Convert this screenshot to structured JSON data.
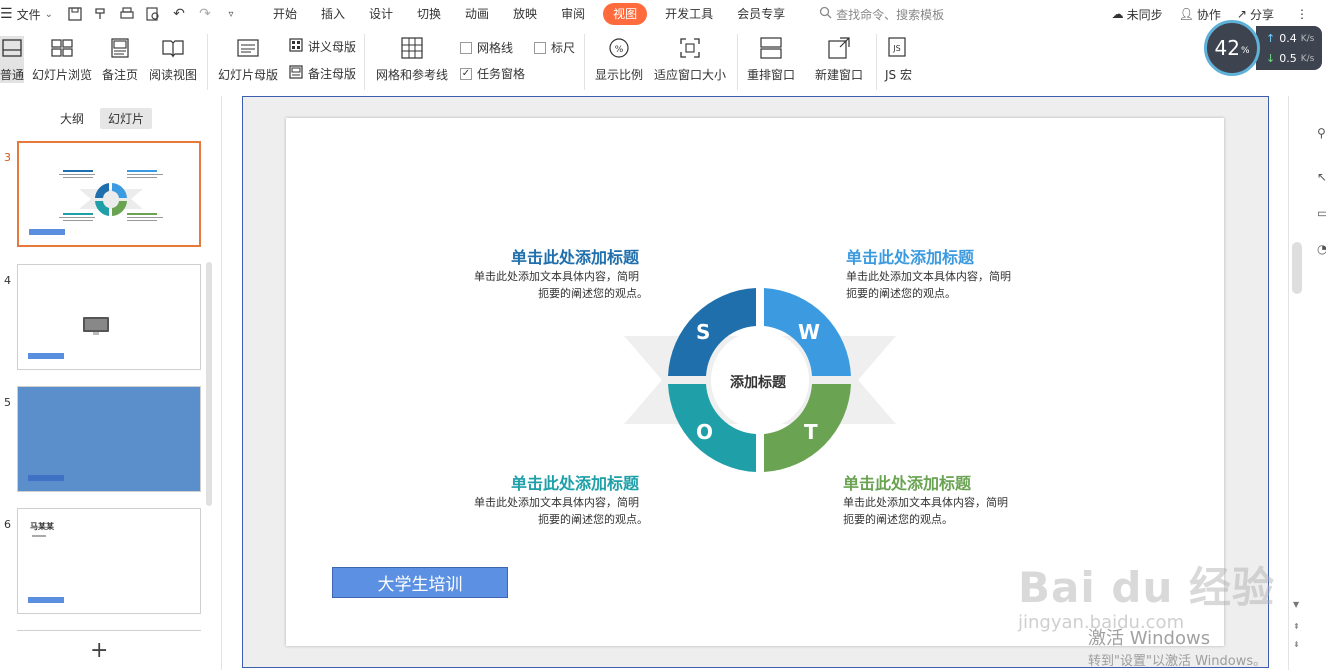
{
  "menu": {
    "file_label": "文件",
    "tabs": [
      "开始",
      "插入",
      "设计",
      "切换",
      "动画",
      "放映",
      "审阅",
      "视图",
      "开发工具",
      "会员专享"
    ],
    "active_tab": "视图",
    "search_placeholder": "查找命令、搜索模板",
    "right": {
      "sync": "未同步",
      "collab": "协作",
      "share": "分享"
    }
  },
  "ribbon": {
    "normal": "普通",
    "slide_sorter": "幻灯片浏览",
    "notes_page": "备注页",
    "reading_view": "阅读视图",
    "slide_master": "幻灯片母版",
    "handout_master": "讲义母版",
    "notes_master": "备注母版",
    "grid_guides": "网格和参考线",
    "gridlines": "网格线",
    "ruler": "标尺",
    "task_pane": "任务窗格",
    "zoom": "显示比例",
    "fit_window": "适应窗口大小",
    "arrange": "重排窗口",
    "new_window": "新建窗口",
    "js_macro": "JS 宏"
  },
  "speed": {
    "percent": "42",
    "unit": "%",
    "up": "0.4",
    "down": "0.5",
    "rate_unit": "K/s"
  },
  "left_panel": {
    "tabs": [
      "大纲",
      "幻灯片"
    ],
    "active": "幻灯片",
    "thumbnails": [
      {
        "num": "3",
        "selected": true
      },
      {
        "num": "4",
        "selected": false
      },
      {
        "num": "5",
        "selected": false
      },
      {
        "num": "6",
        "selected": false,
        "title": "马某某"
      }
    ],
    "add": "+"
  },
  "slide": {
    "center_label": "添加标题",
    "letters": {
      "s": "S",
      "w": "W",
      "o": "O",
      "t": "T"
    },
    "quadrants": [
      {
        "title": "单击此处添加标题",
        "line1": "单击此处添加文本具体内容，简明",
        "line2": "扼要的阐述您的观点。"
      },
      {
        "title": "单击此处添加标题",
        "line1": "单击此处添加文本具体内容，简明",
        "line2": "扼要的阐述您的观点。"
      },
      {
        "title": "单击此处添加标题",
        "line1": "单击此处添加文本具体内容，简明",
        "line2": "扼要的阐述您的观点。"
      },
      {
        "title": "单击此处添加标题",
        "line1": "单击此处添加文本具体内容，简明",
        "line2": "扼要的阐述您的观点。"
      }
    ],
    "footer": "大学生培训"
  },
  "watermark": {
    "brand": "Bai du 经验",
    "url": "jingyan.baidu.com",
    "activate_title": "激活 Windows",
    "activate_sub": "转到\"设置\"以激活 Windows。"
  },
  "colors": {
    "s": "#1f6fad",
    "w": "#3c9be0",
    "o": "#1fa0a8",
    "t": "#6aa352",
    "accent_tab": "#ff6b3c",
    "footer_box": "#5b90e2"
  }
}
